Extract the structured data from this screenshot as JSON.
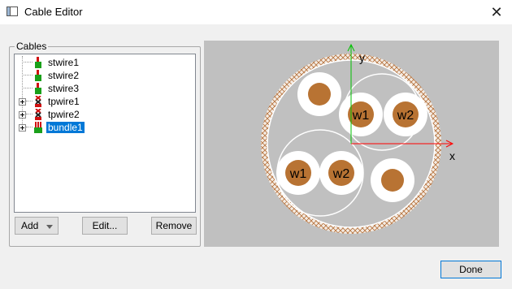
{
  "window": {
    "title": "Cable Editor"
  },
  "cables_group": {
    "label": "Cables",
    "items": [
      {
        "label": "stwire1",
        "icon": "single-wire-icon"
      },
      {
        "label": "stwire2",
        "icon": "single-wire-icon"
      },
      {
        "label": "stwire3",
        "icon": "single-wire-icon"
      },
      {
        "label": "tpwire1",
        "icon": "twisted-pair-icon",
        "expandable": true
      },
      {
        "label": "tpwire2",
        "icon": "twisted-pair-icon",
        "expandable": true
      },
      {
        "label": "bundle1",
        "icon": "bundle-icon",
        "expandable": true,
        "selected": true
      }
    ]
  },
  "buttons": {
    "add": "Add",
    "edit": "Edit...",
    "remove": "Remove",
    "done": "Done"
  },
  "canvas": {
    "axis_x": "x",
    "axis_y": "y",
    "wire_labels": [
      "w1",
      "w2",
      "w1",
      "w2"
    ]
  },
  "colors": {
    "selection": "#0078d7",
    "canvas_bg": "#c0c0c0",
    "copper": "#b87333",
    "x_axis": "#ff0000",
    "y_axis": "#00c000",
    "icon_green": "#1aa01a",
    "icon_red": "#d01010"
  }
}
